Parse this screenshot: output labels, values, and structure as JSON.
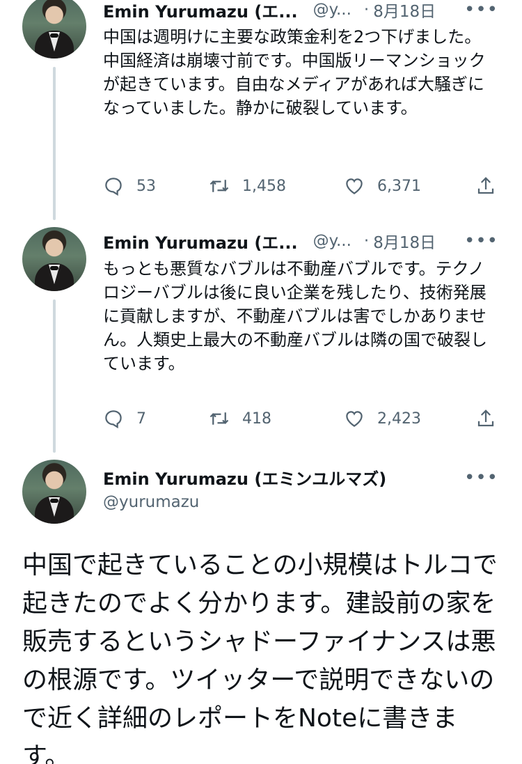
{
  "tweets": [
    {
      "name": "Emin Yurumazu (エ...",
      "handle": "@y...",
      "date": "8月18日",
      "text": "中国は週明けに主要な政策金利を2つ下げました。中国経済は崩壊寸前です。中国版リーマンショックが起きています。自由なメディアがあれば大騒ぎになっていました。静かに破裂しています。",
      "replies": "53",
      "retweets": "1,458",
      "likes": "6,371"
    },
    {
      "name": "Emin Yurumazu (エ...",
      "handle": "@y...",
      "date": "8月18日",
      "text": "もっとも悪質なバブルは不動産バブルです。テクノロジーバブルは後に良い企業を残したり、技術発展に貢献しますが、不動産バブルは害でしかありません。人類史上最大の不動産バブルは隣の国で破裂しています。",
      "replies": "7",
      "retweets": "418",
      "likes": "2,423"
    }
  ],
  "main_tweet": {
    "name": "Emin Yurumazu (エミンユルマズ)",
    "handle": "@yurumazu",
    "text": "中国で起きていることの小規模はトルコで起きたのでよく分かります。建設前の家を販売するというシャドーファイナンスは悪の根源です。ツイッターで説明できないので近く詳細のレポートをNoteに書きます。"
  },
  "icons": {
    "reply": "comment-bubble-icon",
    "retweet": "retweet-icon",
    "like": "heart-icon",
    "share": "share-icon",
    "more": "more-dots-icon"
  },
  "colors": {
    "text": "#0f1419",
    "secondary": "#536471",
    "thread_line": "#cfd9de"
  }
}
